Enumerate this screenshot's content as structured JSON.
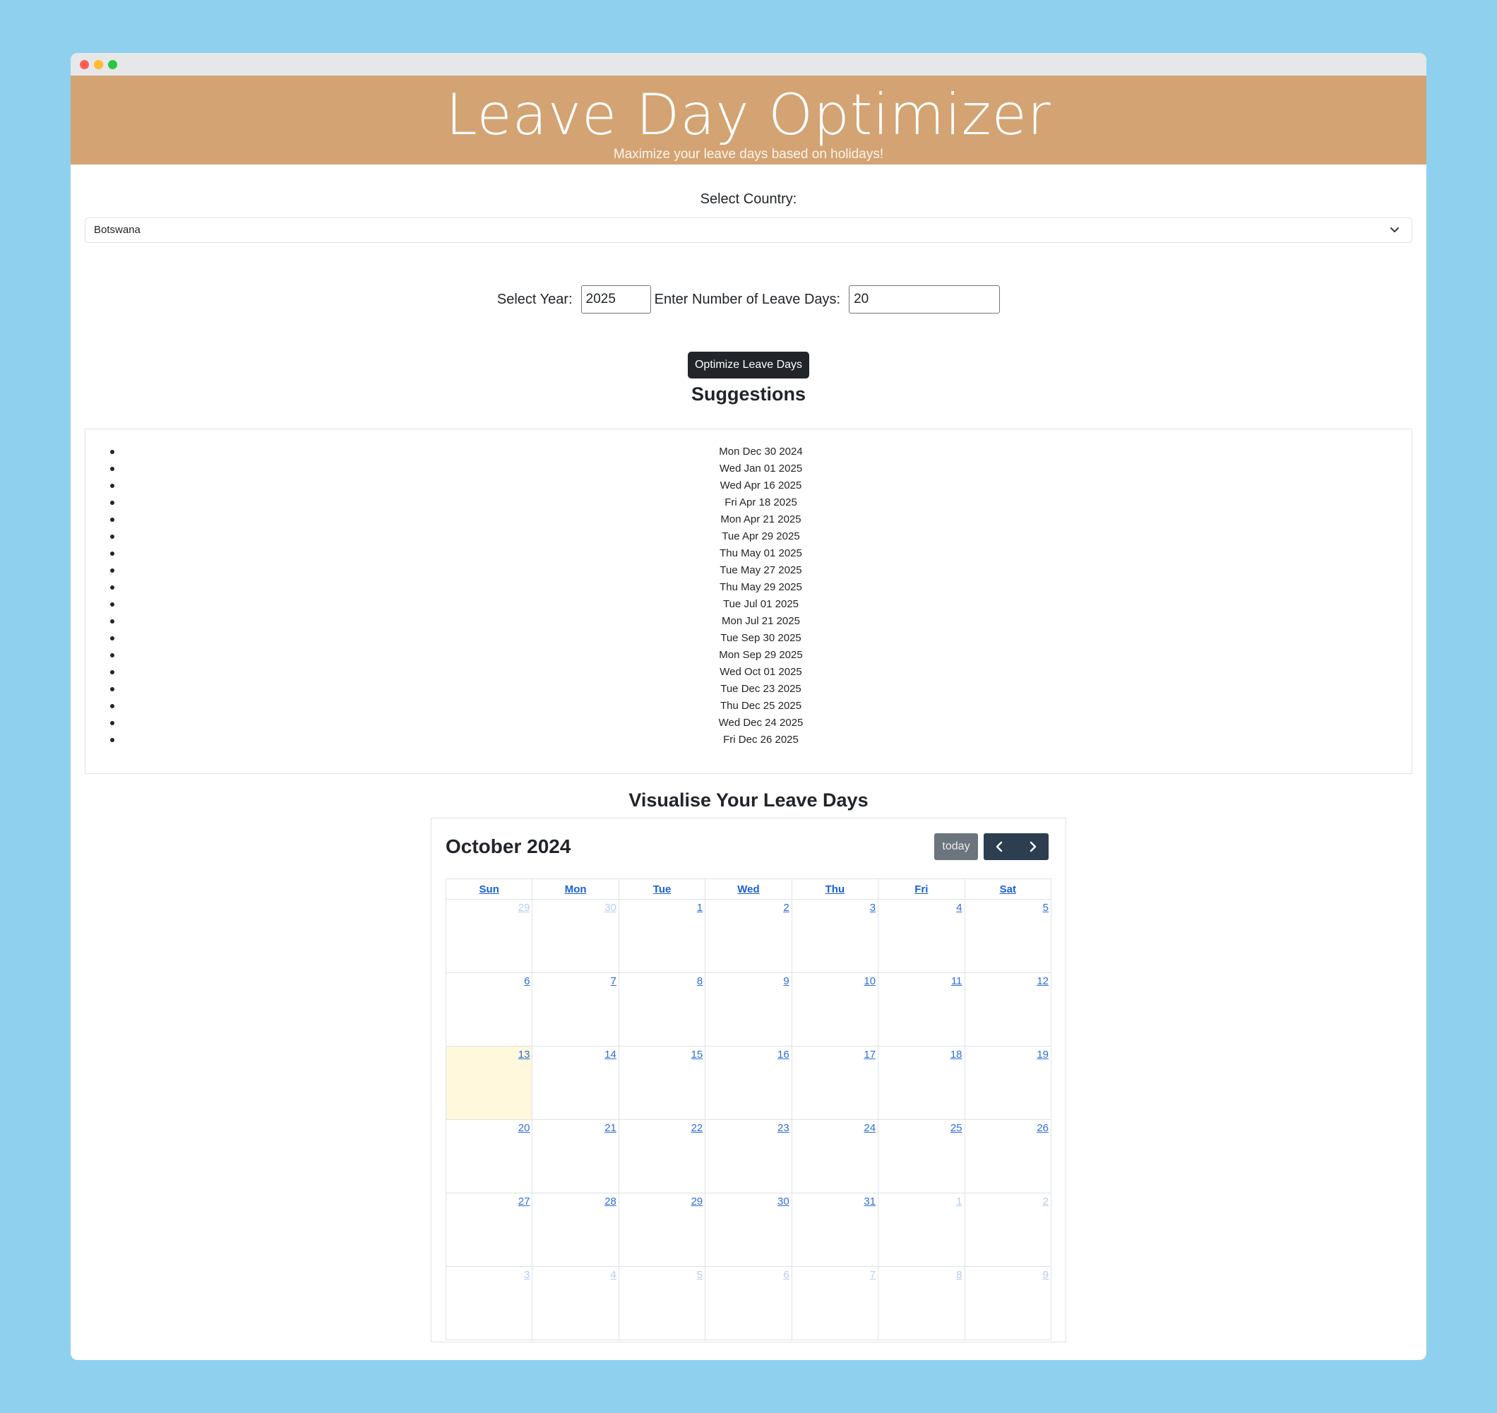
{
  "banner": {
    "title": "Leave Day Optimizer",
    "subtitle": "Maximize your leave days based on holidays!"
  },
  "form": {
    "country_label": "Select Country:",
    "country_value": "Botswana",
    "year_label": "Select Year:",
    "year_value": "2025",
    "days_label": "Enter Number of Leave Days:",
    "days_value": "20",
    "optimize_button": "Optimize Leave Days"
  },
  "suggestions": {
    "heading": "Suggestions",
    "items": [
      "Mon Dec 30 2024",
      "Wed Jan 01 2025",
      "Wed Apr 16 2025",
      "Fri Apr 18 2025",
      "Mon Apr 21 2025",
      "Tue Apr 29 2025",
      "Thu May 01 2025",
      "Tue May 27 2025",
      "Thu May 29 2025",
      "Tue Jul 01 2025",
      "Mon Jul 21 2025",
      "Tue Sep 30 2025",
      "Mon Sep 29 2025",
      "Wed Oct 01 2025",
      "Tue Dec 23 2025",
      "Thu Dec 25 2025",
      "Wed Dec 24 2025",
      "Fri Dec 26 2025"
    ]
  },
  "calendar": {
    "heading": "Visualise Your Leave Days",
    "month_title": "October 2024",
    "today_button": "today",
    "prev_icon": "chevron-left-icon",
    "next_icon": "chevron-right-icon",
    "weekdays": [
      "Sun",
      "Mon",
      "Tue",
      "Wed",
      "Thu",
      "Fri",
      "Sat"
    ],
    "weeks": [
      [
        "29",
        "30",
        "1",
        "2",
        "3",
        "4",
        "5"
      ],
      [
        "6",
        "7",
        "8",
        "9",
        "10",
        "11",
        "12"
      ],
      [
        "13",
        "14",
        "15",
        "16",
        "17",
        "18",
        "19"
      ],
      [
        "20",
        "21",
        "22",
        "23",
        "24",
        "25",
        "26"
      ],
      [
        "27",
        "28",
        "29",
        "30",
        "31",
        "1",
        "2"
      ],
      [
        "3",
        "4",
        "5",
        "6",
        "7",
        "8",
        "9"
      ]
    ],
    "other_month_cells": [
      [
        0,
        0
      ],
      [
        0,
        1
      ],
      [
        4,
        5
      ],
      [
        4,
        6
      ],
      [
        5,
        0
      ],
      [
        5,
        1
      ],
      [
        5,
        2
      ],
      [
        5,
        3
      ],
      [
        5,
        4
      ],
      [
        5,
        5
      ],
      [
        5,
        6
      ]
    ],
    "today_cell": [
      2,
      0
    ],
    "colors": {
      "link": "#2c6fdb",
      "other_month": "#b5cdef",
      "today_bg": "#fff8dc",
      "nav_bg": "#2c3e50",
      "today_btn_bg": "#6c757d"
    }
  },
  "colors": {
    "page_bg": "#8fd0ef",
    "banner_bg": "#d3a373",
    "button_dark": "#212529"
  }
}
